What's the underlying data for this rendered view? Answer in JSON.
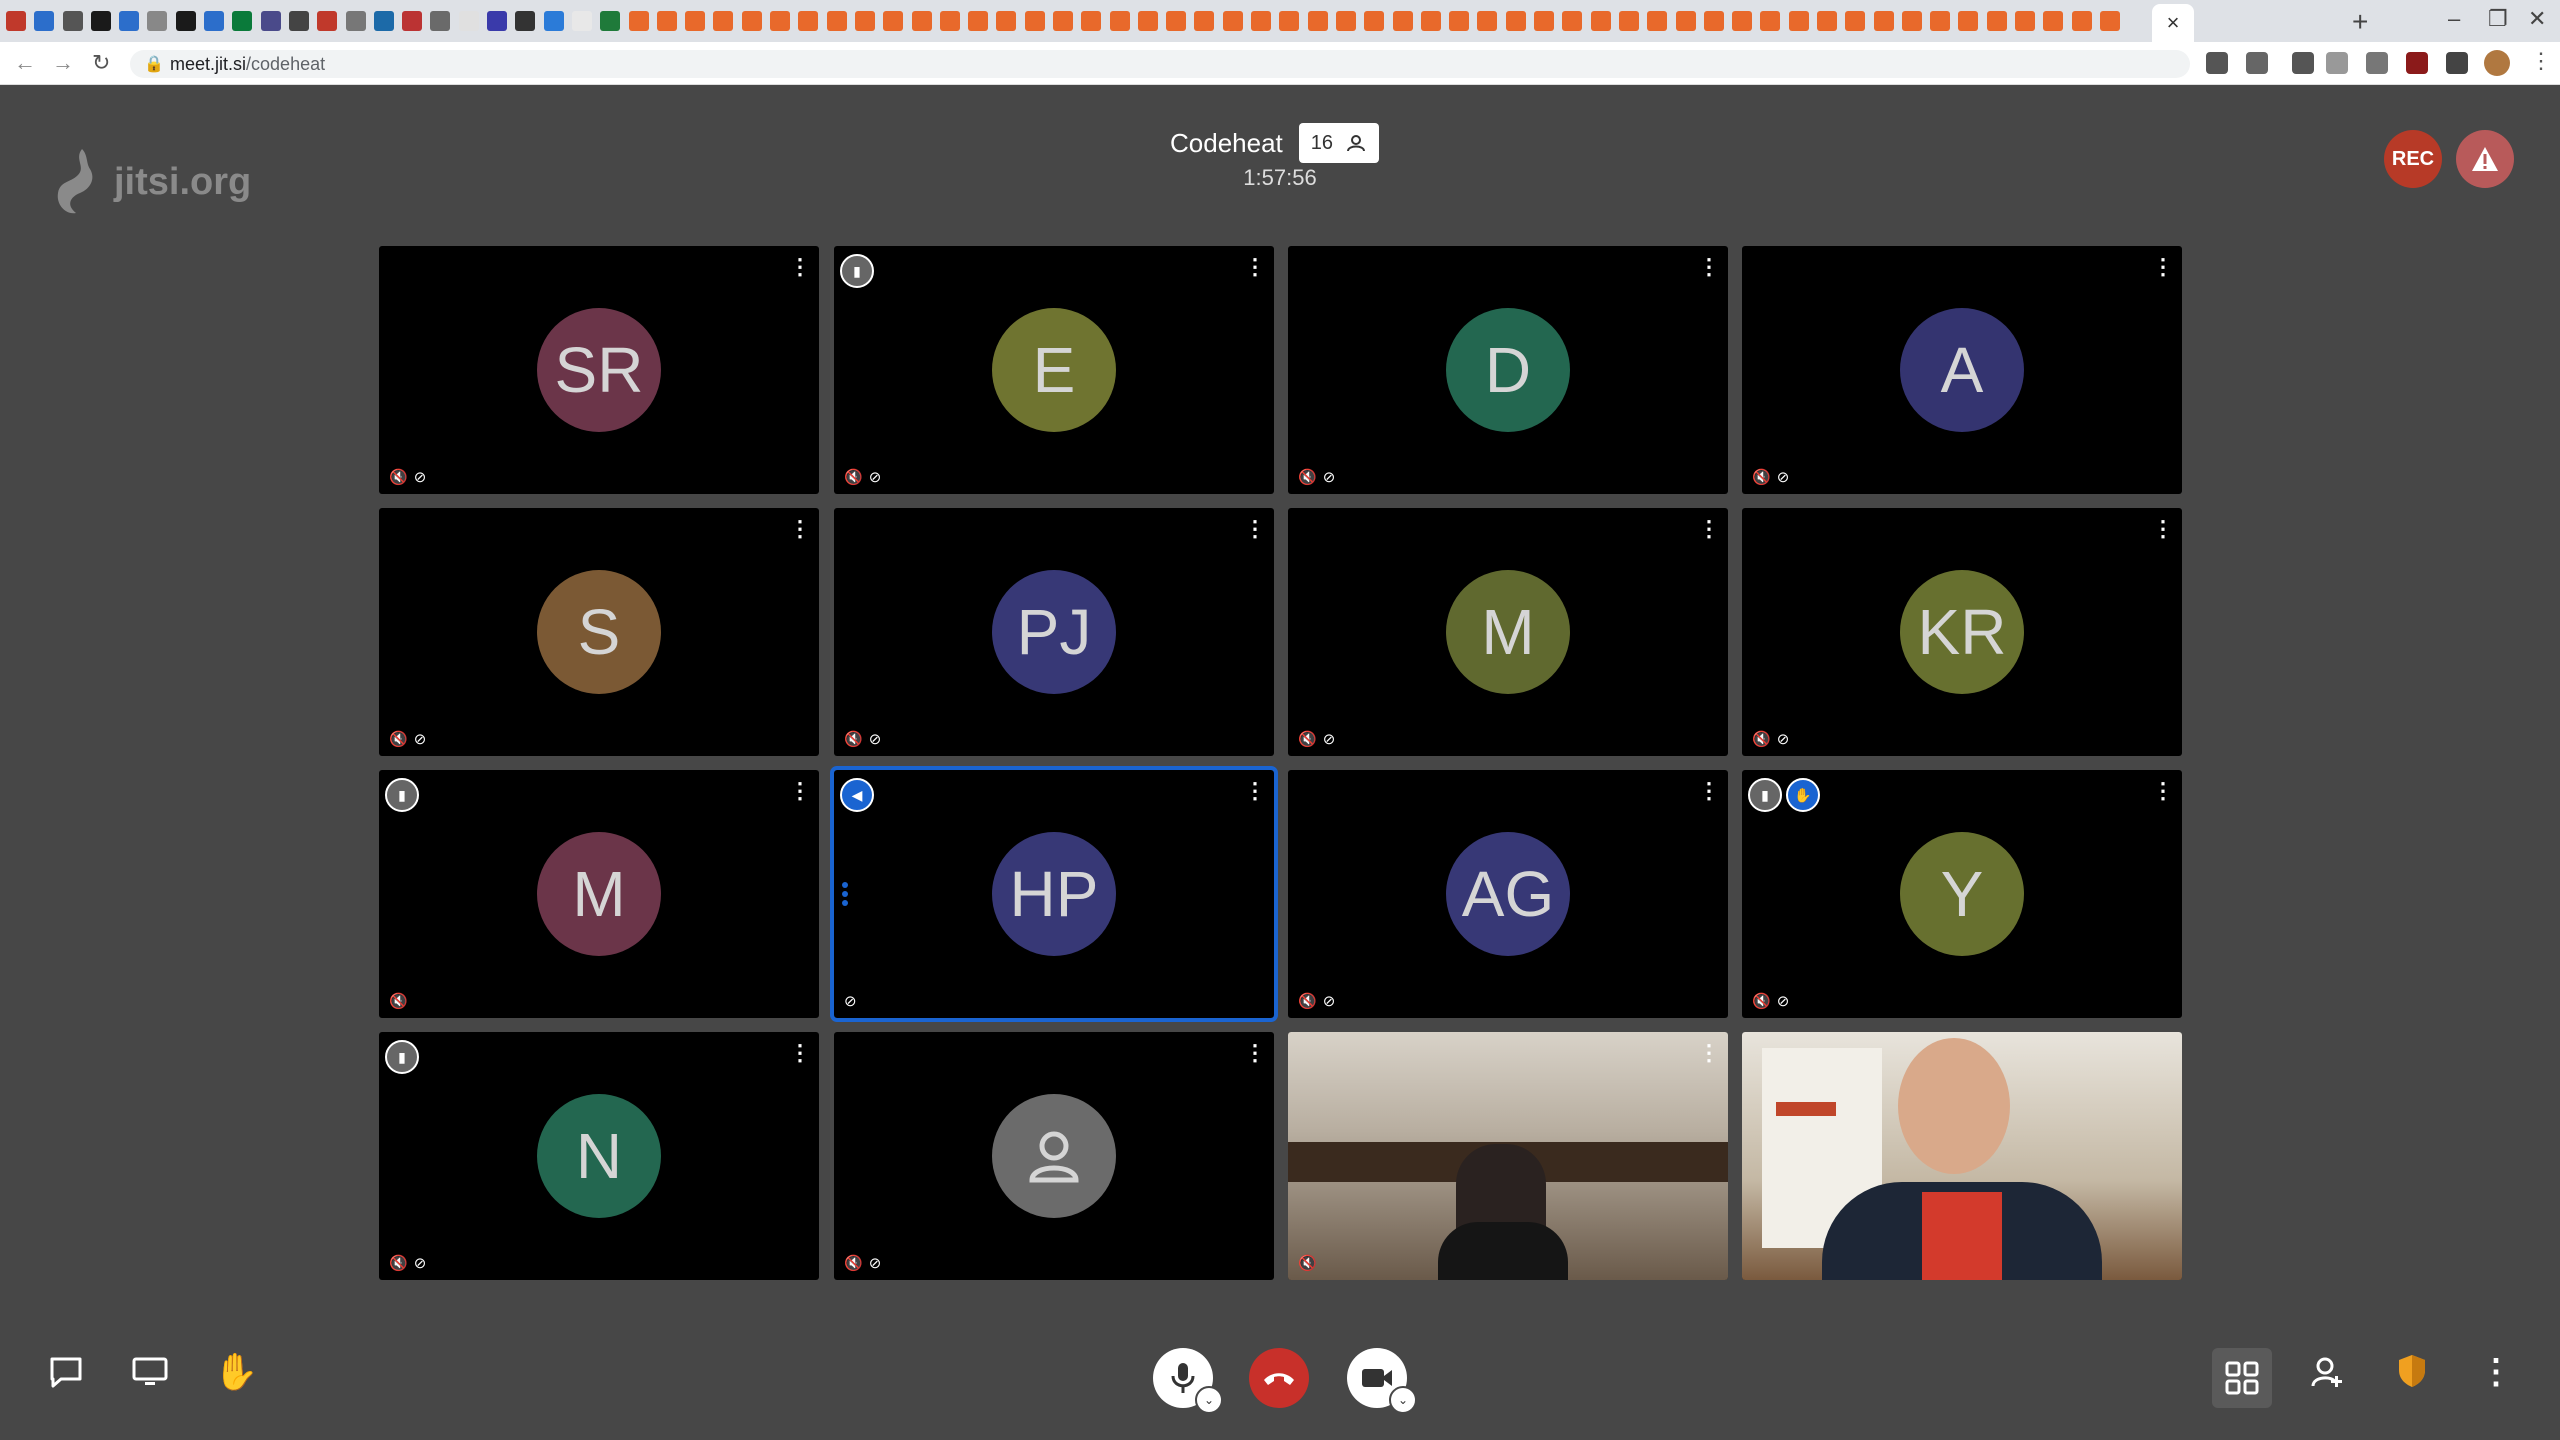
{
  "browser": {
    "url_host": "meet.jit.si",
    "url_path": "/codeheat",
    "close_tab": "×",
    "new_tab": "+",
    "minimize": "–",
    "restore": "❐",
    "close_window": "✕"
  },
  "meeting": {
    "logo_text": "jitsi.org",
    "title": "Codeheat",
    "participant_count": "16",
    "elapsed": "1:57:56",
    "rec_label": "REC"
  },
  "tiles": [
    {
      "initials": "SR",
      "color": "#6b3549"
    },
    {
      "initials": "E",
      "color": "#6f7430"
    },
    {
      "initials": "D",
      "color": "#236750"
    },
    {
      "initials": "A",
      "color": "#343470"
    },
    {
      "initials": "S",
      "color": "#7b5934"
    },
    {
      "initials": "PJ",
      "color": "#373876"
    },
    {
      "initials": "M",
      "color": "#60692f"
    },
    {
      "initials": "KR",
      "color": "#67702f"
    },
    {
      "initials": "M",
      "color": "#6b3549"
    },
    {
      "initials": "HP",
      "color": "#373876"
    },
    {
      "initials": "AG",
      "color": "#373876"
    },
    {
      "initials": "Y",
      "color": "#67702f"
    },
    {
      "initials": "N",
      "color": "#236750"
    },
    {
      "initials": "",
      "color": "#6b6b6b"
    },
    {
      "initials": "",
      "color": "#6a5a4a"
    },
    {
      "initials": "",
      "color": "#8a7a6a"
    }
  ],
  "icons": {
    "more": "⋮",
    "mic_muted": "🎙̸",
    "cam_off": "▣",
    "signal": "📶",
    "hand": "✋",
    "speaker": "📢",
    "chevron": "⌄",
    "lock": "🔒"
  }
}
